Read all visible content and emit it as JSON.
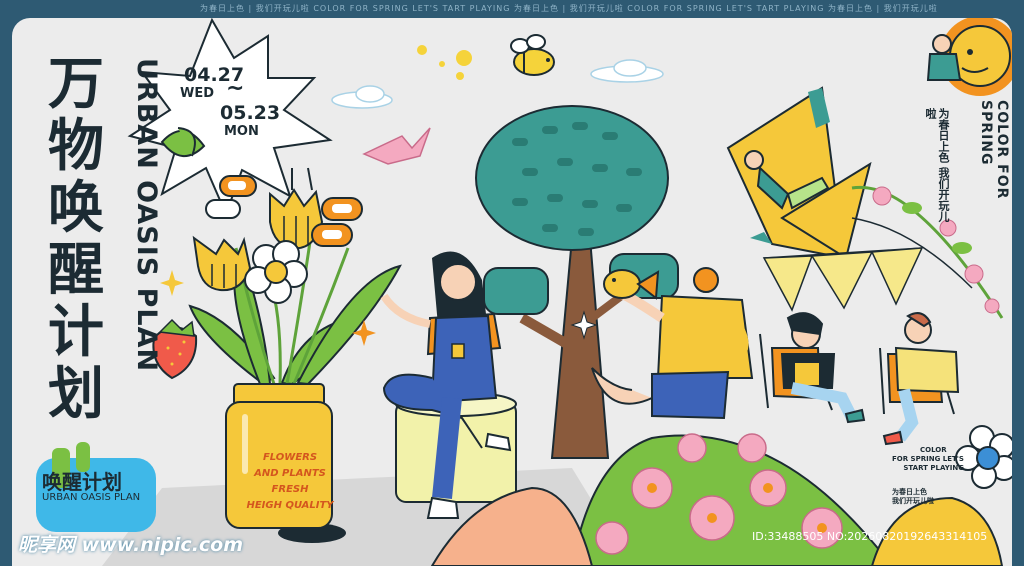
{
  "frame": {
    "top_text": "为春日上色 | 我们开玩儿啦   COLOR FOR SPRING LET'S TART PLAYING   为春日上色 | 我们开玩儿啦   COLOR FOR SPRING LET'S TART PLAYING   为春日上色 | 我们开玩儿啦"
  },
  "title": {
    "chinese_chars": [
      "万",
      "物",
      "唤",
      "醒",
      "计",
      "划"
    ],
    "english": "URBAN OASIS PLAN"
  },
  "dates": {
    "start": "04.27",
    "start_day": "WED",
    "tilde": "~",
    "end": "05.23",
    "end_day": "MON"
  },
  "right_slogan": {
    "chinese": "为春日上色 我们开玩儿啦",
    "english": "COLOR FOR SPRING"
  },
  "jar_text": [
    "FLOWERS",
    "AND PLANTS",
    "FRESH",
    "HEIGH QUALITY"
  ],
  "logo_badge": {
    "chinese": "唤醒计划",
    "english": "URBAN OASIS PLAN"
  },
  "small_right": {
    "line1": "COLOR",
    "line2": "FOR SPRING LET'S",
    "line3": "START PLAYING",
    "cn1": "为春日上色",
    "cn2": "我们开玩儿啦"
  },
  "watermark": "昵享网 www.nipic.com",
  "image_id": "ID:33488505 NO:20260820192643314105",
  "colors": {
    "frame": "#2e5a73",
    "panel": "#ececec",
    "text_dark": "#1c2b33",
    "tree": "#3c9c93",
    "orange": "#f29320",
    "yellow": "#f5c83a",
    "pink": "#f4a9c0",
    "green": "#7bc043",
    "blue_jeans": "#3d63b8"
  }
}
